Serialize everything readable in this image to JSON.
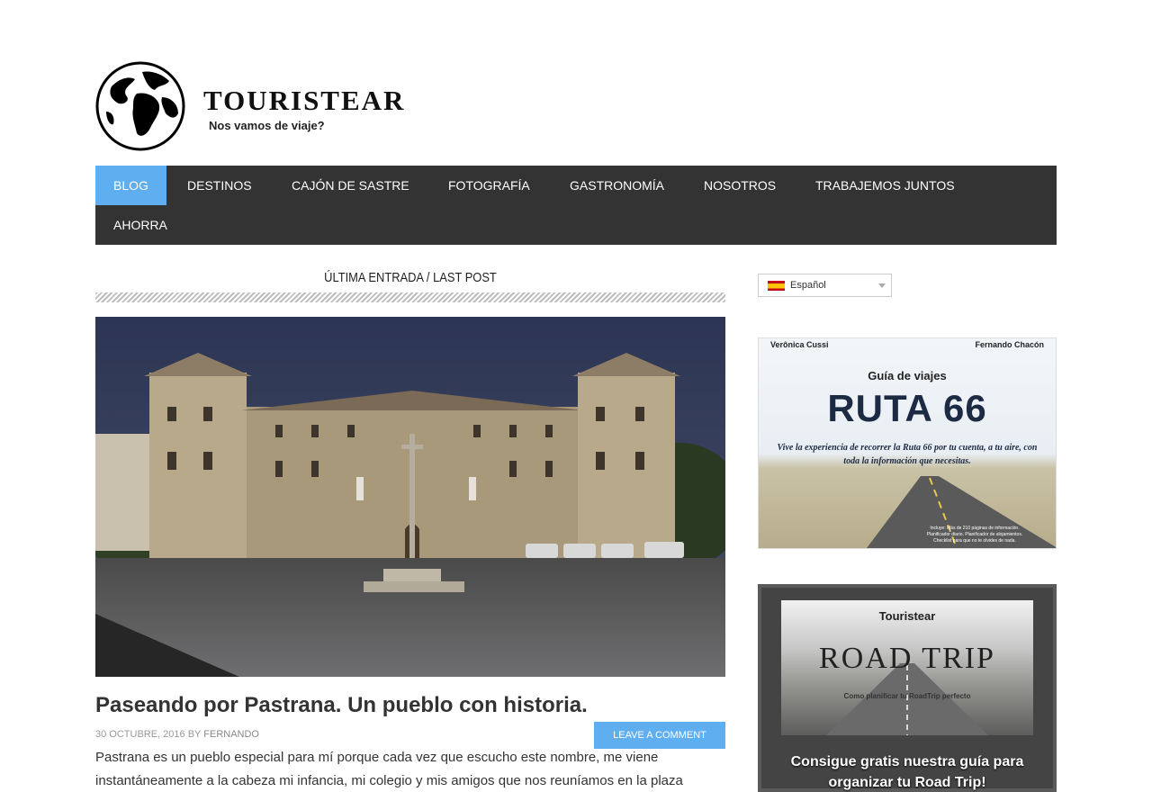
{
  "site": {
    "title": "TOURISTEAR",
    "tagline": "Nos vamos de viaje?"
  },
  "nav": {
    "items": [
      {
        "label": "BLOG",
        "active": true
      },
      {
        "label": "DESTINOS"
      },
      {
        "label": "CAJÓN DE SASTRE"
      },
      {
        "label": "FOTOGRAFÍA"
      },
      {
        "label": "GASTRONOMÍA"
      },
      {
        "label": "NOSOTROS"
      },
      {
        "label": "TRABAJEMOS JUNTOS"
      },
      {
        "label": "AHORRA"
      }
    ],
    "active_color": "#5eaef0",
    "bg_color": "#333333"
  },
  "main": {
    "section_heading": "ÚLTIMA ENTRADA / LAST POST",
    "post": {
      "title": "Paseando por Pastrana. Un pueblo con historia.",
      "date": "30 OCTUBRE, 2016",
      "by": "BY",
      "author": "FERNANDO",
      "comment_label": "LEAVE A COMMENT",
      "excerpt": "Pastrana es un pueblo especial para mí porque cada vez que escucho este nombre, me viene instantáneamente a la cabeza mi infancia, mi colegio y mis amigos que nos reuníamos en la plaza"
    }
  },
  "sidebar": {
    "language": {
      "label": "Español",
      "icon": "spain-flag-icon"
    },
    "ad_ruta": {
      "author_left": "Verônica Cussi",
      "author_right": "Fernando Chacón",
      "guide": "Guía de viajes",
      "title": "RUTA 66",
      "slogan": "Vive la experiencia de recorrer la Ruta 66 por tu cuenta, a tu aire, con toda la información que necesitas.",
      "includes": "Incluye: Más de 210 páginas de información. Planificador diario. Planificador de alojamientos. Checklist para que no te olvides de nada."
    },
    "ad_road": {
      "brand": "Touristear",
      "title": "ROAD TRIP",
      "subtitle": "Como planificar tu RoadTrip perfecto",
      "cta": "Consigue gratis nuestra guía para organizar tu Road Trip!"
    }
  }
}
